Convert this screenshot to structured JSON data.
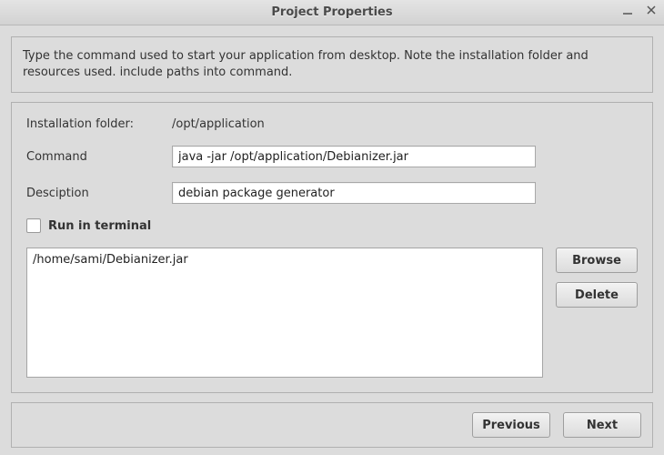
{
  "window": {
    "title": "Project Properties"
  },
  "help": {
    "text": "Type the command used to start your application from desktop. Note the installation folder and resources used. include paths into command."
  },
  "form": {
    "install_label": "Installation folder:",
    "install_value": "/opt/application",
    "command_label": "Command",
    "command_value": "java -jar /opt/application/Debianizer.jar",
    "description_label": "Desciption",
    "description_value": "debian package generator",
    "run_in_terminal_label": "Run in terminal",
    "run_in_terminal_checked": false
  },
  "files": {
    "items": [
      "/home/sami/Debianizer.jar"
    ]
  },
  "buttons": {
    "browse": "Browse",
    "delete": "Delete",
    "previous": "Previous",
    "next": "Next"
  }
}
